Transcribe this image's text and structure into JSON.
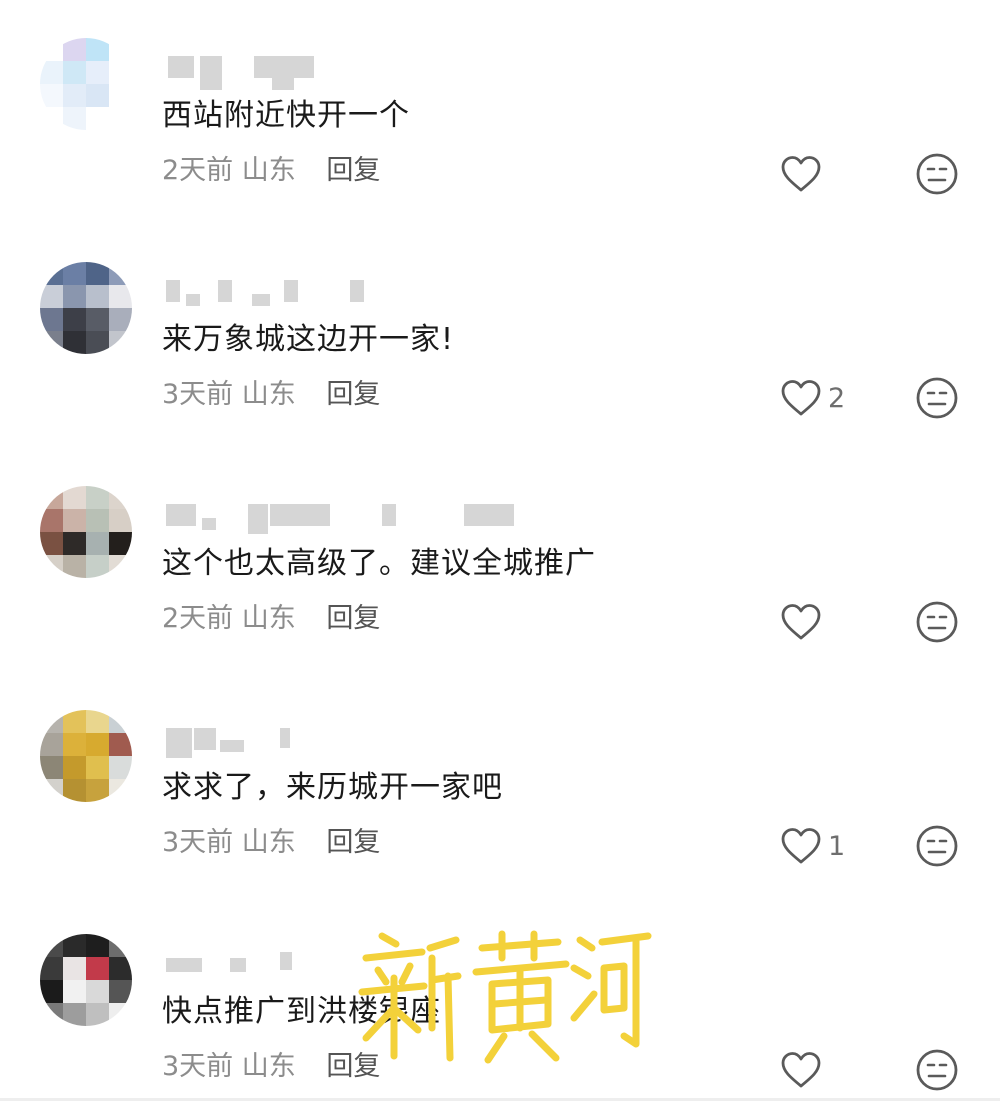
{
  "comments": [
    {
      "text": "西站附近快开一个",
      "time": "2天前",
      "location": "山东",
      "reply_label": "回复",
      "likes": "",
      "avatar_colors": [
        "#ffffff",
        "#dcd6f0",
        "#bfe4f7",
        "#ffffff",
        "#eaf3fb",
        "#cfe8f6",
        "#e6eefa",
        "#ffffff",
        "#f4f8fd",
        "#e2ecf8",
        "#d9e6f5",
        "#ffffff",
        "#ffffff",
        "#eef4fb",
        "#ffffff",
        "#ffffff"
      ]
    },
    {
      "text": "来万象城这边开一家!",
      "time": "3天前",
      "location": "山东",
      "reply_label": "回复",
      "likes": "2",
      "avatar_colors": [
        "#5a6f93",
        "#6b7fa5",
        "#4f6488",
        "#8d9bb8",
        "#c9ced8",
        "#8a96ae",
        "#b8bfcc",
        "#e8e8ec",
        "#6d7790",
        "#3d3f48",
        "#585c66",
        "#a9aebb",
        "#7a7f8c",
        "#2f3036",
        "#4a4d55",
        "#c2c5cc"
      ]
    },
    {
      "text": "这个也太高级了。建议全城推广",
      "time": "2天前",
      "location": "山东",
      "reply_label": "回复",
      "likes": "",
      "avatar_colors": [
        "#c7a79a",
        "#e3d9d2",
        "#c8d0c7",
        "#dcd4cc",
        "#a9756a",
        "#cbb3a8",
        "#b8c0b5",
        "#d7cfc6",
        "#7a5142",
        "#2e2a28",
        "#a7b1b0",
        "#231f1c",
        "#d6d0c8",
        "#b9b2a6",
        "#c6cfc8",
        "#e2dcd5"
      ]
    },
    {
      "text": "求求了，来历城开一家吧",
      "time": "3天前",
      "location": "山东",
      "reply_label": "回复",
      "likes": "1",
      "avatar_colors": [
        "#b6b3ad",
        "#e3c25a",
        "#e9d68e",
        "#c9d0d4",
        "#a8a39a",
        "#dcb13a",
        "#d7aa2f",
        "#a05b4f",
        "#8c8676",
        "#c49a2c",
        "#e0bf4e",
        "#d9dcdb",
        "#d3d1cc",
        "#b59132",
        "#c7a23d",
        "#ebe8e0"
      ]
    },
    {
      "text": "快点推广到洪楼银座",
      "time": "3天前",
      "location": "山东",
      "reply_label": "回复",
      "likes": "",
      "avatar_colors": [
        "#4a4a4a",
        "#2a2a2a",
        "#1e1e1e",
        "#6d6d6d",
        "#3a3a3a",
        "#e9e4e4",
        "#c23a4a",
        "#2c2c2c",
        "#1b1b1b",
        "#f1f1f1",
        "#d9d9d9",
        "#555555",
        "#7a7a7a",
        "#9d9d9d",
        "#bfbfbf",
        "#eeeeee"
      ]
    }
  ],
  "icons": {
    "like": "heart-outline-icon",
    "dislike": "neutral-face-icon"
  },
  "watermark_text": "新黄河",
  "colors": {
    "watermark": "#f3d13a",
    "icon_stroke": "#5a5a5a"
  }
}
